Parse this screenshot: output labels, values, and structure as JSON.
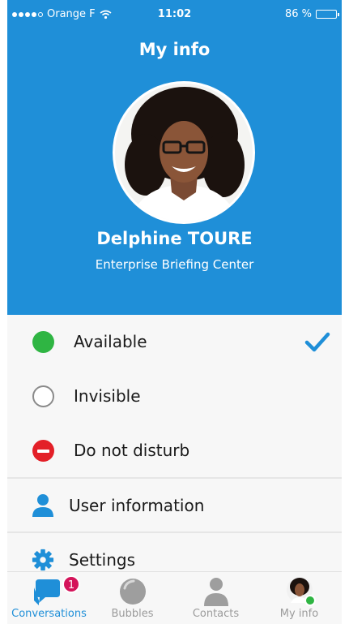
{
  "status_bar": {
    "carrier": "Orange F",
    "time": "11:02",
    "battery": "86 %",
    "battery_level": 0.86
  },
  "header": {
    "title": "My info",
    "name": "Delphine TOURE",
    "company": "Enterprise Briefing Center"
  },
  "presence_options": [
    {
      "label": "Available",
      "icon": "green-status-icon",
      "selected": true
    },
    {
      "label": "Invisible",
      "icon": "empty-circle-status-icon",
      "selected": false
    },
    {
      "label": "Do not disturb",
      "icon": "do-not-disturb-icon",
      "selected": false
    }
  ],
  "menu": [
    {
      "label": "User information",
      "icon": "person-icon"
    },
    {
      "label": "Settings",
      "icon": "gear-icon"
    }
  ],
  "tabs": [
    {
      "label": "Conversations",
      "icon": "chat-bubbles-icon",
      "active": true,
      "badge": "1"
    },
    {
      "label": "Bubbles",
      "icon": "bubble-icon",
      "active": false
    },
    {
      "label": "Contacts",
      "icon": "person-icon",
      "active": false
    },
    {
      "label": "My info",
      "icon": "avatar-icon",
      "active": false
    }
  ],
  "colors": {
    "brand_blue": "#1f8fd8",
    "available_green": "#2fb543",
    "dnd_red": "#e32028",
    "badge": "#d4145a"
  }
}
